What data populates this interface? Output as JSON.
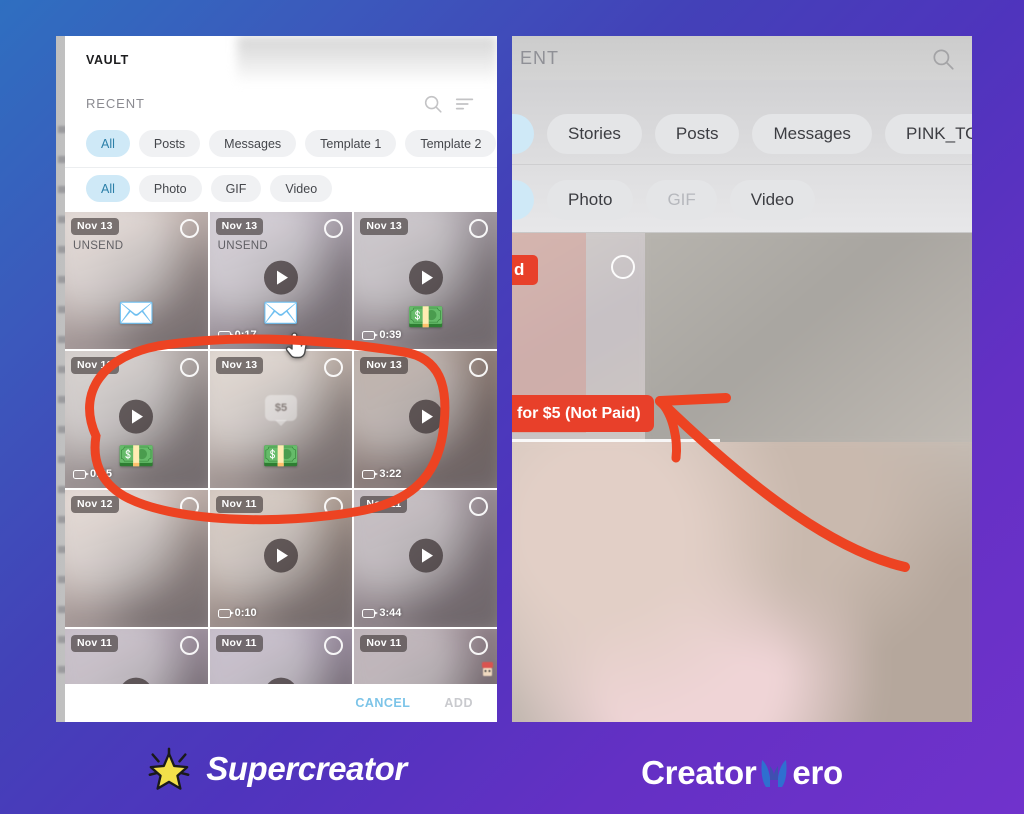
{
  "background": {
    "gradient_from": "#2f6fc0",
    "gradient_to": "#7032cc"
  },
  "left_panel": {
    "name": "supercreator-vault-modal",
    "title": "VAULT",
    "section_label": "RECENT",
    "header_icons": [
      {
        "name": "search-icon",
        "label": "Search"
      },
      {
        "name": "sort-icon",
        "label": "Sort"
      }
    ],
    "source_chips": [
      {
        "label": "All",
        "active": true
      },
      {
        "label": "Posts",
        "active": false
      },
      {
        "label": "Messages",
        "active": false
      },
      {
        "label": "Template 1",
        "active": false
      },
      {
        "label": "Template 2",
        "active": false
      }
    ],
    "type_chips": [
      {
        "label": "All",
        "active": true,
        "dim": false
      },
      {
        "label": "Photo",
        "active": false,
        "dim": false
      },
      {
        "label": "GIF",
        "active": false,
        "dim": false
      },
      {
        "label": "Video",
        "active": false,
        "dim": false
      }
    ],
    "grid": [
      {
        "date": "Nov 13",
        "unsend": "UNSEND",
        "play": false,
        "duration": "",
        "emoji": "mail",
        "tint": "#d7c6bd",
        "price": ""
      },
      {
        "date": "Nov 13",
        "unsend": "UNSEND",
        "play": true,
        "duration": "0:17",
        "emoji": "mail",
        "tint": "#b7aebe",
        "price": ""
      },
      {
        "date": "Nov 13",
        "unsend": "",
        "play": true,
        "duration": "0:39",
        "emoji": "money",
        "tint": "#a79fa8",
        "price": ""
      },
      {
        "date": "Nov 13",
        "unsend": "",
        "play": true,
        "duration": "0:25",
        "emoji": "money",
        "tint": "#bdb4ae",
        "price": ""
      },
      {
        "date": "Nov 13",
        "unsend": "",
        "play": false,
        "duration": "",
        "emoji": "money",
        "tint": "#d3c3b4",
        "price": "$5"
      },
      {
        "date": "Nov 13",
        "unsend": "",
        "play": true,
        "duration": "3:22",
        "emoji": "",
        "tint": "#8d7668",
        "price": ""
      },
      {
        "date": "Nov 12",
        "unsend": "",
        "play": false,
        "duration": "",
        "emoji": "",
        "tint": "#d9c6ba",
        "price": ""
      },
      {
        "date": "Nov 11",
        "unsend": "",
        "play": true,
        "duration": "0:10",
        "emoji": "",
        "tint": "#c0aa97",
        "price": ""
      },
      {
        "date": "Nov 11",
        "unsend": "",
        "play": true,
        "duration": "3:44",
        "emoji": "",
        "tint": "#9b8d96",
        "price": ""
      },
      {
        "date": "Nov 11",
        "unsend": "",
        "play": true,
        "duration": "",
        "emoji": "",
        "tint": "#a292a6",
        "price": ""
      },
      {
        "date": "Nov 11",
        "unsend": "",
        "play": true,
        "duration": "",
        "emoji": "",
        "tint": "#9f90ab",
        "price": ""
      },
      {
        "date": "Nov 11",
        "unsend": "",
        "play": false,
        "duration": "",
        "emoji": "",
        "tint": "#8e7a85",
        "price": ""
      }
    ],
    "footer": {
      "cancel_label": "CANCEL",
      "cancel_color": "#7cc4e8",
      "add_label": "ADD",
      "add_color": "#c9cace"
    },
    "cursor": "pointing-hand"
  },
  "right_panel": {
    "name": "creatorhero-vault-modal",
    "section_label": "ENT",
    "search_icon": "search-icon",
    "source_chips": [
      {
        "label": "Stories"
      },
      {
        "label": "Posts"
      },
      {
        "label": "Messages"
      },
      {
        "label": "PINK_TOP"
      }
    ],
    "type_chips": [
      {
        "label": "Photo",
        "dim": false
      },
      {
        "label": "GIF",
        "dim": true
      },
      {
        "label": "Video",
        "dim": false
      }
    ],
    "badges": [
      {
        "name": "unsend-badge-partial",
        "text": "d",
        "color": "#e8402a"
      },
      {
        "name": "price-paid-status-badge",
        "text": "for $5 (Not Paid)",
        "color": "#e8402a"
      }
    ]
  },
  "annotations": {
    "color": "#ed4322",
    "shapes": [
      {
        "name": "highlight-ellipse",
        "target": "left-panel-grid-row-2"
      },
      {
        "name": "pointer-arrow",
        "target": "right-panel-price-badge"
      }
    ]
  },
  "brands": {
    "left": {
      "name": "supercreator",
      "text": "Supercreator",
      "icon": "star-icon",
      "icon_color": "#f2e04a",
      "text_color": "#ffffff"
    },
    "right": {
      "name": "creatorhero",
      "text_before": "Creator",
      "text_after": "ero",
      "icon": "hero-mask-icon",
      "icon_color": "#2f6fd0",
      "text_color": "#ffffff"
    }
  }
}
